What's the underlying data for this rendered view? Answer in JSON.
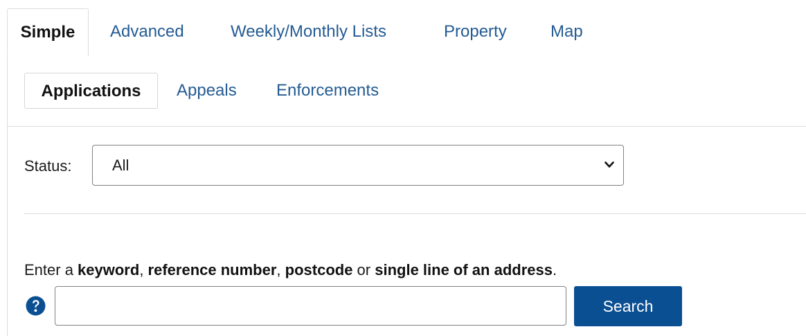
{
  "top_tabs": [
    {
      "label": "Simple",
      "active": true
    },
    {
      "label": "Advanced",
      "active": false
    },
    {
      "label": "Weekly/Monthly Lists",
      "active": false
    },
    {
      "label": "Property",
      "active": false
    },
    {
      "label": "Map",
      "active": false
    }
  ],
  "sub_tabs": [
    {
      "label": "Applications",
      "active": true
    },
    {
      "label": "Appeals",
      "active": false
    },
    {
      "label": "Enforcements",
      "active": false
    }
  ],
  "status": {
    "label": "Status:",
    "selected_value": "All",
    "icon": "chevron-down-icon"
  },
  "instructions": {
    "prefix": "Enter a ",
    "term1": "keyword",
    "sep1": ", ",
    "term2": "reference number",
    "sep2": ", ",
    "term3": "postcode",
    "sep3": " or ",
    "term4": "single line of an address",
    "suffix": "."
  },
  "search": {
    "help_icon": "question-circle-icon",
    "value": "",
    "placeholder": "",
    "button_label": "Search"
  },
  "colors": {
    "link": "#245b93",
    "primary_button": "#0b4f93",
    "border": "#dcdcdc",
    "text": "#1a1a1a"
  }
}
